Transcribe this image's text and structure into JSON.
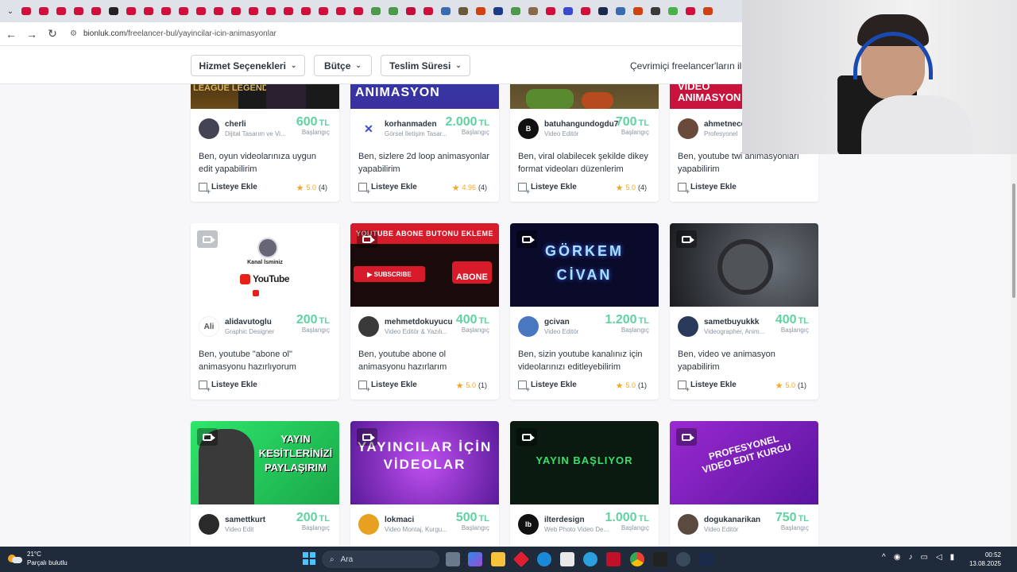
{
  "browser": {
    "url_domain": "bionluk.com",
    "url_path": "/freelancer-bul/yayincilar-icin-animasyonlar"
  },
  "filters": {
    "service": "Hizmet Seçenekleri",
    "budget": "Bütçe",
    "delivery": "Teslim Süresi",
    "online": "Çevrimiçi freelancer'ların ilan"
  },
  "cards": [
    {
      "seller": "cherli",
      "role": "Dijital Tasarım ve Vi...",
      "price": "600",
      "currency": "TL",
      "from": "Başlangıç",
      "title": "Ben, oyun videolarınıza uygun edit yapabilirim",
      "list": "Listeye Ekle",
      "rating": "5.0",
      "count": "(4)",
      "thumb": "LEAGUE LEGENDS"
    },
    {
      "seller": "korhanmaden",
      "role": "Görsel İletişim Tasar...",
      "price": "2.000",
      "currency": "TL",
      "from": "Başlangıç",
      "title": "Ben, sizlere 2d loop animasyonlar yapabilirim",
      "list": "Listeye Ekle",
      "rating": "4.96",
      "count": "(4)",
      "thumb": "ANIMASYON"
    },
    {
      "seller": "batuhangundogdu7",
      "role": "Video Editör",
      "price": "700",
      "currency": "TL",
      "from": "Başlangıç",
      "title": "Ben, viral olabilecek şekilde dikey format videoları düzenlerim",
      "list": "Listeye Ekle",
      "rating": "5.0",
      "count": "(4)",
      "thumb": ""
    },
    {
      "seller": "ahmetnecd",
      "role": "Profesyonel",
      "price": "",
      "currency": "",
      "from": "",
      "title": "Ben, youtube twi animasyonları yapabilirim",
      "list": "Listeye Ekle",
      "rating": "",
      "count": "",
      "thumb": "VIDEO ANIMASYON"
    },
    {
      "seller": "alidavutoglu",
      "role": "Graphic Designer",
      "price": "200",
      "currency": "TL",
      "from": "Başlangıç",
      "title": "Ben, youtube \"abone ol\" animasyonu hazırlıyorum",
      "list": "Listeye Ekle",
      "rating": "",
      "count": "",
      "thumb": "Kanal İsminiz"
    },
    {
      "seller": "mehmetdokuyucu",
      "role": "Video Editör & Yazılı...",
      "price": "400",
      "currency": "TL",
      "from": "Başlangıç",
      "title": "Ben, youtube abone ol animasyonu hazırlarım",
      "list": "Listeye Ekle",
      "rating": "5.0",
      "count": "(1)",
      "thumb": "YOUTUBE ABONE BUTONU EKLEME"
    },
    {
      "seller": "gcivan",
      "role": "Video Editör",
      "price": "1.200",
      "currency": "TL",
      "from": "Başlangıç",
      "title": "Ben, sizin youtube kanalınız için videolarınızı editleyebilirim",
      "list": "Listeye Ekle",
      "rating": "5.0",
      "count": "(1)",
      "thumb": "GÖRKEM CİVAN"
    },
    {
      "seller": "sametbuyukkk",
      "role": "Videographer, Anim...",
      "price": "400",
      "currency": "TL",
      "from": "Başlangıç",
      "title": "Ben, video ve animasyon yapabilirim",
      "list": "Listeye Ekle",
      "rating": "5.0",
      "count": "(1)",
      "thumb": ""
    },
    {
      "seller": "samettkurt",
      "role": "Video Edit",
      "price": "200",
      "currency": "TL",
      "from": "Başlangıç",
      "title": "",
      "list": "",
      "rating": "",
      "count": "",
      "thumb": "YAYIN KESİTLERİNİZİ PAYLAŞIRIM"
    },
    {
      "seller": "lokmaci",
      "role": "Video Montaj, Kurgu...",
      "price": "500",
      "currency": "TL",
      "from": "Başlangıç",
      "title": "",
      "list": "",
      "rating": "",
      "count": "",
      "thumb": "YAYINCILAR İÇİN VİDEOLAR"
    },
    {
      "seller": "ilterdesign",
      "role": "Web Photo Video De...",
      "price": "1.000",
      "currency": "TL",
      "from": "Başlangıç",
      "title": "",
      "list": "",
      "rating": "",
      "count": "",
      "thumb": "YAYIN BAŞLIYOR"
    },
    {
      "seller": "dogukanarikan",
      "role": "Video Editör",
      "price": "750",
      "currency": "TL",
      "from": "Başlangıç",
      "title": "",
      "list": "",
      "rating": "",
      "count": "",
      "thumb": "PROFESYONEL VIDEO EDIT KURGU"
    }
  ],
  "taskbar": {
    "temp": "21°C",
    "weather": "Parçalı bulutlu",
    "search": "Ara",
    "time": "00:52",
    "date": "13.08.2025"
  },
  "colors": {
    "accent": "#5fd3a0",
    "star": "#f5a623",
    "youtube": "#e62117"
  }
}
